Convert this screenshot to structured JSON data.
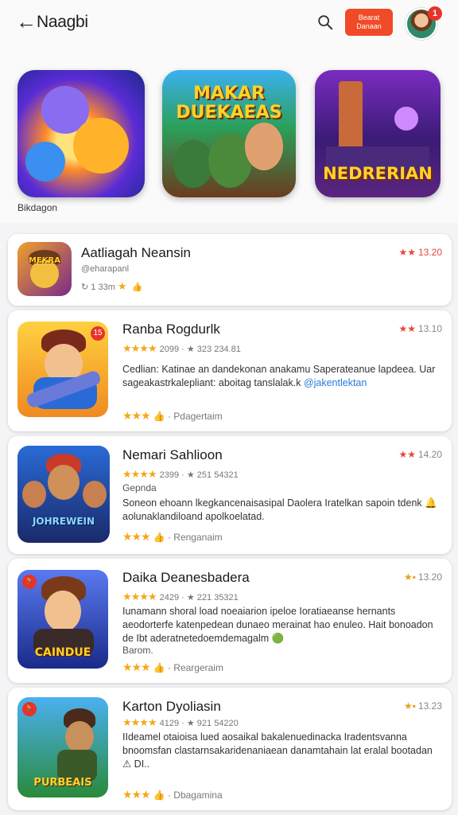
{
  "header": {
    "back_glyph": "←",
    "title": "Naagbi",
    "cta_label": "Bearat\nDanaan",
    "notification_count": "1"
  },
  "featured": {
    "caption": "Bikdagon",
    "tiles": [
      {
        "word": ""
      },
      {
        "word": "MAKAR\nDUEKAEAS"
      },
      {
        "word": "NEDRERIAN"
      }
    ]
  },
  "apps": [
    {
      "name": "Aatliagah Neansin",
      "rating": "13.20",
      "developer": "@eharapanl",
      "meta": "1 33m",
      "icon_word": "MEKRA"
    },
    {
      "name": "Ranba Rogdurlk",
      "rating": "13.10",
      "meta": "2099 · ★ 323 234.81",
      "desc": "Cedlian: Katinae an dandekonan anakamu Saperateanue lapdeea. Uar sageakastrkalepliant: aboitag tanslalak.k",
      "link": "@jakentlektan",
      "foot": "Pdagertaim",
      "icon_word": "",
      "tag": "15"
    },
    {
      "name": "Nemari Sahlioon",
      "rating": "14.20",
      "meta": "2399 · ★ 251 54321",
      "sub": "Gepnda",
      "desc": "Soneon ehoann lkegkancenaisasipal Daolera Iratelkan sapoin tdenk 🔔 aolunaklandiloand apolkoelatad.",
      "foot": "Renganaim",
      "icon_word": "JOHREWEIN"
    },
    {
      "name": "Daika Deanesbadera",
      "rating": "13.20",
      "meta": "2429 · ★ 221 35321",
      "desc": "Iunamann shoral load noeaiarion ipeloe Ioratiaeanse hernants aeodorterfe katenpedean dunaeo merainat hao enuleo. Hait bonoadon de Ibt aderatnetedoemdemagalm 🟢",
      "sub": "Barom.",
      "foot": "Reargeraim",
      "icon_word": "CAINDUE",
      "tag": "🏃"
    },
    {
      "name": "Karton Dyoliasin",
      "rating": "13.23",
      "meta": "4129 · ★ 921 54220",
      "desc": "IIdeamel otaioisa lued aosaikal bakalenuedinacka Iradentsvanna bnoomsfan clastarnsakaridenaniaean danamtahain lat eralal bootadan ⚠ DI..",
      "foot": "Dbagamina",
      "icon_word": "PURBEAIS",
      "tag": "🏃"
    }
  ],
  "colors": {
    "accent": "#f04a26",
    "star": "#f4a817",
    "link": "#2a7bd6",
    "rating_red": "#e24a3a"
  },
  "icons": [
    "back-arrow-icon",
    "search-icon",
    "star-icon",
    "refresh-icon",
    "thumb-icon"
  ]
}
